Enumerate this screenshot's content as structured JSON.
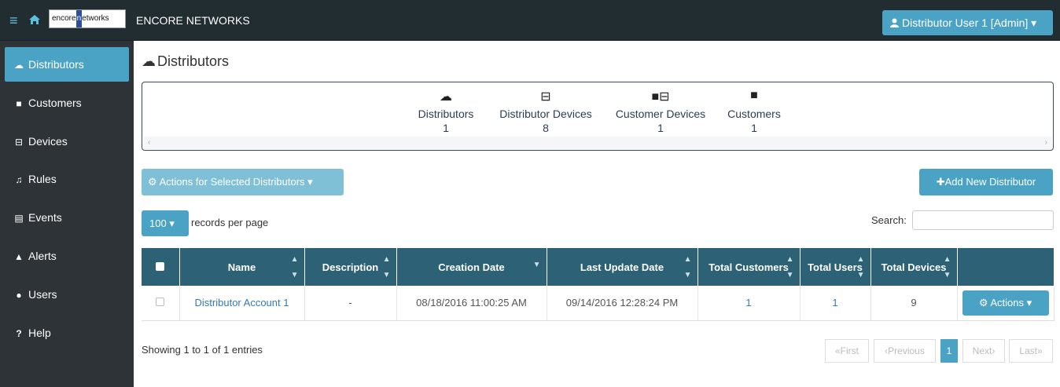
{
  "header": {
    "menu_icon": "hamburger-icon",
    "home_icon": "home-icon",
    "logo_text": "encore networks",
    "brand": "ENCORE NETWORKS",
    "user_menu_label": "Distributor User 1 [Admin]",
    "user_menu_caret": "▾"
  },
  "sidebar": {
    "items": [
      {
        "label": "Distributors",
        "icon": "cloud-icon",
        "active": true
      },
      {
        "label": "Customers",
        "icon": "briefcase-icon"
      },
      {
        "label": "Devices",
        "icon": "hdd-icon"
      },
      {
        "label": "Rules",
        "icon": "bell-icon"
      },
      {
        "label": "Events",
        "icon": "document-icon"
      },
      {
        "label": "Alerts",
        "icon": "warning-icon"
      },
      {
        "label": "Users",
        "icon": "users-icon"
      },
      {
        "label": "Help",
        "icon": "question-icon"
      }
    ]
  },
  "page": {
    "title": "Distributors"
  },
  "stats": [
    {
      "label": "Distributors",
      "value": "1",
      "icon": "cloud-icon"
    },
    {
      "label": "Distributor Devices",
      "value": "8",
      "icon": "hdd-icon"
    },
    {
      "label": "Customer Devices",
      "value": "1",
      "icon": "briefcase-hdd-icon"
    },
    {
      "label": "Customers",
      "value": "1",
      "icon": "briefcase-icon"
    }
  ],
  "toolbar": {
    "actions_selected_label": "Actions for Selected Distributors",
    "add_label": "Add New Distributor",
    "per_page_value": "100",
    "per_page_label": "records per page",
    "search_label": "Search:",
    "search_value": ""
  },
  "table": {
    "columns": [
      "Name",
      "Description",
      "Creation Date",
      "Last Update Date",
      "Total Customers",
      "Total Users",
      "Total Devices"
    ],
    "rows": [
      {
        "name": "Distributor Account 1",
        "description": "-",
        "creation_date": "08/18/2016 11:00:25 AM",
        "last_update": "09/14/2016 12:28:24 PM",
        "total_customers": "1",
        "total_users": "1",
        "total_devices": "9",
        "actions_label": "Actions"
      }
    ]
  },
  "footer": {
    "showing": "Showing 1 to 1 of 1 entries",
    "first": "«First",
    "previous": "‹Previous",
    "current_page": "1",
    "next": "Next›",
    "last": "Last»"
  },
  "colors": {
    "accent": "#4aa3c4",
    "topbar": "#222d32",
    "sidebar": "#2e3338",
    "table_header": "#2c6176"
  }
}
